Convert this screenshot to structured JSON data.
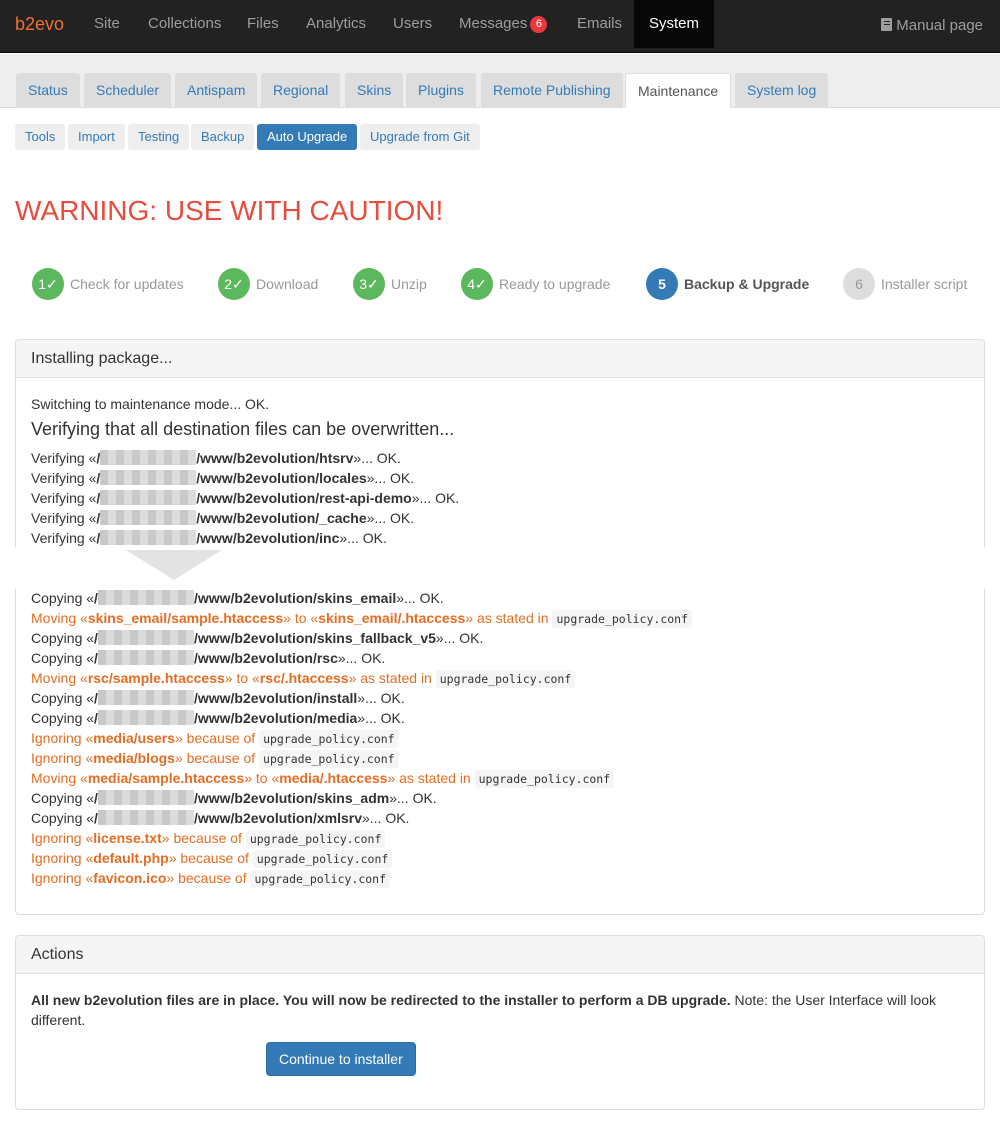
{
  "navbar": {
    "brand": "b2evo",
    "items": [
      "Site",
      "Collections",
      "Files",
      "Analytics",
      "Users",
      "Messages",
      "Emails",
      "System"
    ],
    "messages_badge": "6",
    "manual": "Manual page"
  },
  "tabs": [
    "Status",
    "Scheduler",
    "Antispam",
    "Regional",
    "Skins",
    "Plugins",
    "Remote Publishing",
    "Maintenance",
    "System log"
  ],
  "subtabs": [
    "Tools",
    "Import",
    "Testing",
    "Backup",
    "Auto Upgrade",
    "Upgrade from Git"
  ],
  "warning": "WARNING: USE WITH CAUTION!",
  "steps": [
    {
      "num": "1✓",
      "label": "Check for updates"
    },
    {
      "num": "2✓",
      "label": "Download"
    },
    {
      "num": "3✓",
      "label": "Unzip"
    },
    {
      "num": "4✓",
      "label": "Ready to upgrade"
    },
    {
      "num": "5",
      "label": "Backup & Upgrade"
    },
    {
      "num": "6",
      "label": "Installer script"
    }
  ],
  "install_panel": {
    "title": "Installing package...",
    "maintenance_line": "Switching to maintenance mode... OK.",
    "verify_heading": "Verifying that all destination files can be overwritten...",
    "verify_prefix": "Verifying «",
    "copy_prefix": "Copying «",
    "ok_suffix": "»... OK.",
    "verify_paths": [
      "/www/b2evolution/htsrv",
      "/www/b2evolution/locales",
      "/www/b2evolution/rest-api-demo",
      "/www/b2evolution/_cache",
      "/www/b2evolution/inc"
    ],
    "copy_paths": {
      "skins_email": "/www/b2evolution/skins_email",
      "skins_fallback": "/www/b2evolution/skins_fallback_v5",
      "rsc": "/www/b2evolution/rsc",
      "install": "/www/b2evolution/install",
      "media": "/www/b2evolution/media",
      "skins_adm": "/www/b2evolution/skins_adm",
      "xmlsrv": "/www/b2evolution/xmlsrv"
    },
    "moving": "Moving «",
    "to": "» to «",
    "as_stated": "» as stated in",
    "ignoring": "Ignoring «",
    "because": "» because of",
    "policy": "upgrade_policy.conf",
    "moves": [
      {
        "from": "skins_email/sample.htaccess",
        "to": "skins_email/.htaccess"
      },
      {
        "from": "rsc/sample.htaccess",
        "to": "rsc/.htaccess"
      },
      {
        "from": "media/sample.htaccess",
        "to": "media/.htaccess"
      }
    ],
    "ignored": [
      "media/users",
      "media/blogs",
      "license.txt",
      "default.php",
      "favicon.ico"
    ]
  },
  "actions_panel": {
    "title": "Actions",
    "bold_text": "All new b2evolution files are in place. You will now be redirected to the installer to perform a DB upgrade.",
    "note": " Note: the User Interface will look different.",
    "button": "Continue to installer"
  },
  "colors": {
    "accent": "#337ab7",
    "warning": "#e74c3c",
    "orange": "#e46d22",
    "success": "#5cb85c",
    "brand": "#f0712e"
  }
}
